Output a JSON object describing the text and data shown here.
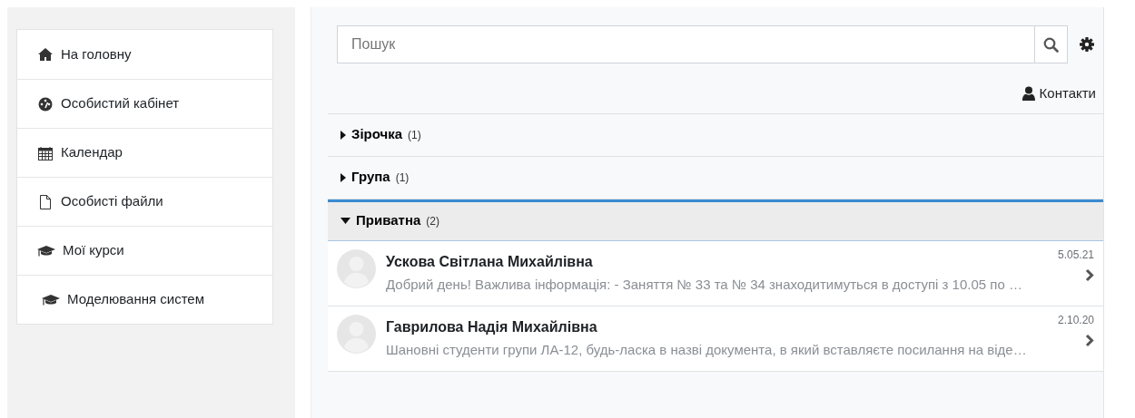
{
  "sidebar": {
    "items": [
      {
        "label": "На головну",
        "kind": "home"
      },
      {
        "label": "Особистий кабінет",
        "kind": "dashboard"
      },
      {
        "label": "Календар",
        "kind": "calendar"
      },
      {
        "label": "Особисті файли",
        "kind": "file"
      },
      {
        "label": "Мої курси",
        "kind": "course",
        "children": [
          {
            "label": "Моделювання систем",
            "kind": "course"
          }
        ]
      }
    ]
  },
  "search": {
    "placeholder": "Пошук"
  },
  "contacts_link": "Контакти",
  "sections": [
    {
      "label": "Зірочка",
      "count": "(1)",
      "expanded": false
    },
    {
      "label": "Група",
      "count": "(1)",
      "expanded": false
    },
    {
      "label": "Приватна",
      "count": "(2)",
      "expanded": true,
      "conversations": [
        {
          "name": "Ускова Світлана Михайлівна",
          "date": "5.05.21",
          "preview": "Добрий день! Важлива інформація: - Заняття № 33 та № 34 знаходитимуться в доступі з 10.05 по …"
        },
        {
          "name": "Гаврилова Надія Михайлівна",
          "date": "2.10.20",
          "preview": "Шановні студенти групи ЛА-12, будь-ласка в назві документа, в який вставляєте посилання на віде…"
        }
      ]
    }
  ]
}
